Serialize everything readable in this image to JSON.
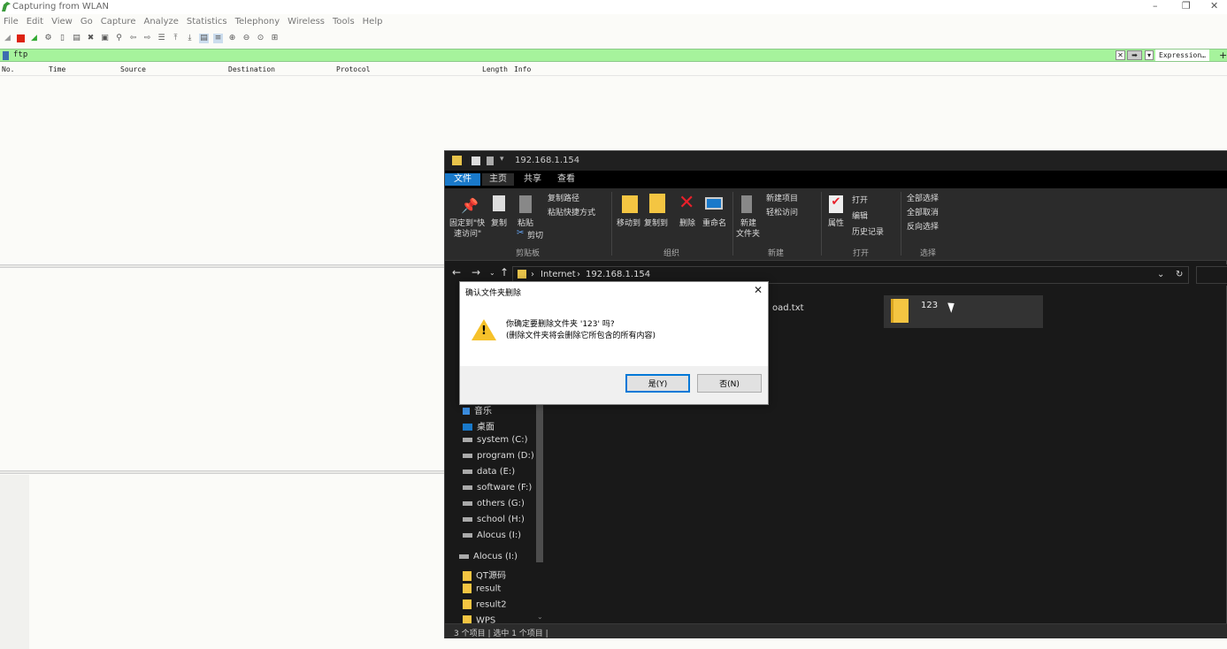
{
  "wireshark": {
    "title": "Capturing from WLAN",
    "menu": [
      "File",
      "Edit",
      "View",
      "Go",
      "Capture",
      "Analyze",
      "Statistics",
      "Telephony",
      "Wireless",
      "Tools",
      "Help"
    ],
    "filter_value": "ftp",
    "expression_label": "Expression…",
    "plus_label": "+",
    "columns": [
      "No.",
      "Time",
      "Source",
      "Destination",
      "Protocol",
      "Length",
      "Info"
    ],
    "filter_color": "#a6f39c"
  },
  "explorer": {
    "title_path": "192.168.1.154",
    "tabs": [
      "文件",
      "主页",
      "共享",
      "查看"
    ],
    "ribbon": {
      "pin_label_1": "固定到\"快",
      "pin_label_2": "速访问\"",
      "copy": "复制",
      "paste": "粘贴",
      "copy_path": "复制路径",
      "paste_shortcut": "粘贴快捷方式",
      "cut": "剪切",
      "clipboard_group": "剪贴板",
      "move_to": "移动到",
      "copy_to": "复制到",
      "delete": "删除",
      "rename": "重命名",
      "organize_group": "组织",
      "new_folder_1": "新建",
      "new_folder_2": "文件夹",
      "new_item": "新建项目",
      "easy_access": "轻松访问",
      "new_group": "新建",
      "properties": "属性",
      "open": "打开",
      "edit": "编辑",
      "history": "历史记录",
      "open_group": "打开",
      "select_all": "全部选择",
      "select_none": "全部取消",
      "invert_selection": "反向选择",
      "select_group": "选择"
    },
    "address": {
      "seg1": "Internet",
      "seg2": "192.168.1.154"
    },
    "nav_items": [
      {
        "label": "音乐"
      },
      {
        "label": "桌面"
      },
      {
        "label": "system (C:)"
      },
      {
        "label": "program (D:)"
      },
      {
        "label": "data (E:)"
      },
      {
        "label": "software (F:)"
      },
      {
        "label": "others (G:)"
      },
      {
        "label": "school (H:)"
      },
      {
        "label": "Alocus (I:)"
      },
      {
        "label": "Alocus (I:)"
      },
      {
        "label": "QT源码"
      },
      {
        "label": "result"
      },
      {
        "label": "result2"
      },
      {
        "label": "WPS"
      }
    ],
    "file_partial": "oad.txt",
    "selected_folder": "123",
    "status": "3 个项目  |  选中 1 个项目  |"
  },
  "dialog": {
    "title": "确认文件夹删除",
    "line1": "你确定要删除文件夹 '123' 吗?",
    "line2": "(删除文件夹将会删除它所包含的所有内容)",
    "yes": "是(Y)",
    "no": "否(N)",
    "close_glyph": "✕"
  }
}
